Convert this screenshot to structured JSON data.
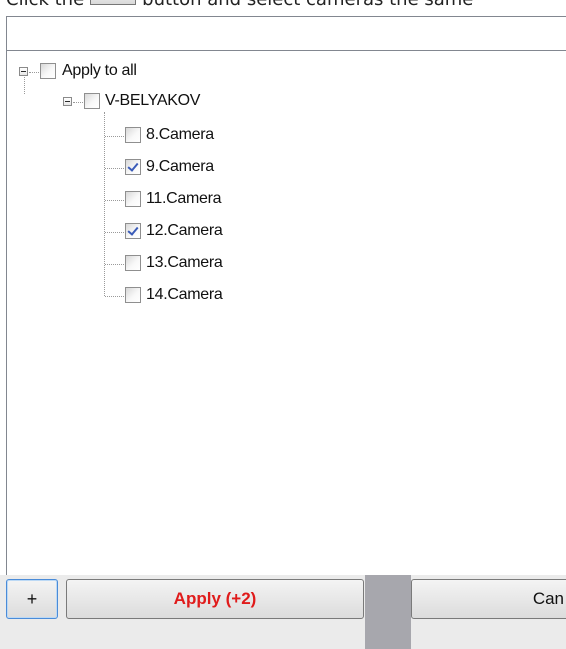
{
  "instruction": {
    "before_button": "Click the",
    "after_button": "button and select cameras the same"
  },
  "tree": {
    "root": {
      "label": "Apply to all",
      "checked": false,
      "expanded": true
    },
    "server": {
      "label": "V-BELYAKOV",
      "checked": false,
      "expanded": true
    },
    "cameras": [
      {
        "label": "8.Camera",
        "checked": false
      },
      {
        "label": "9.Camera",
        "checked": true
      },
      {
        "label": "11.Camera",
        "checked": false
      },
      {
        "label": "12.Camera",
        "checked": true
      },
      {
        "label": "13.Camera",
        "checked": false
      },
      {
        "label": "14.Camera",
        "checked": false
      }
    ]
  },
  "buttons": {
    "add_label": "+",
    "apply_label": "Apply (+2)",
    "cancel_label": "Can"
  },
  "colors": {
    "apply_text": "#e01b1b",
    "check_mark": "#3a5bb8",
    "border": "#828790"
  },
  "icons": {
    "expander": "minus-expander-icon",
    "check": "checkmark-icon"
  }
}
